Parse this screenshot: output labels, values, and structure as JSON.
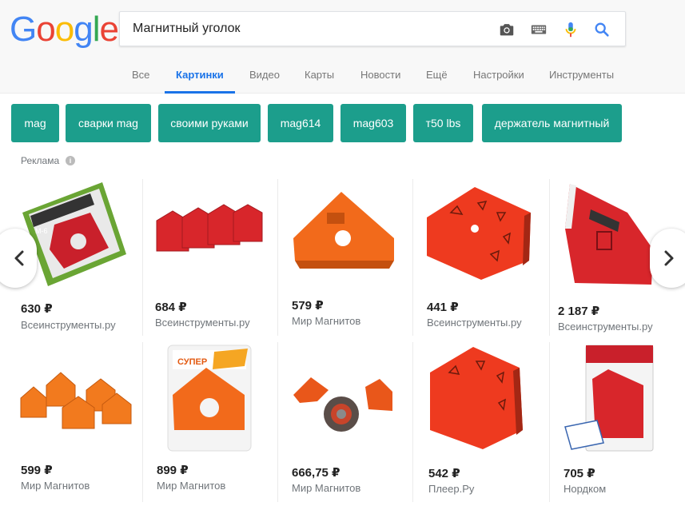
{
  "header": {
    "logo": [
      "G",
      "o",
      "o",
      "g",
      "l",
      "e"
    ],
    "logo_colors": [
      "#4285f4",
      "#ea4335",
      "#fbbc05",
      "#4285f4",
      "#34a853",
      "#ea4335"
    ],
    "search_value": "Магнитный уголок"
  },
  "tabs": [
    {
      "label": "Все"
    },
    {
      "label": "Картинки"
    },
    {
      "label": "Видео"
    },
    {
      "label": "Карты"
    },
    {
      "label": "Новости"
    },
    {
      "label": "Ещё"
    },
    {
      "label": "Настройки"
    },
    {
      "label": "Инструменты"
    }
  ],
  "chips": [
    "mag",
    "сварки mag",
    "своими руками",
    "mag614",
    "mag603",
    "т50 lbs",
    "держатель магнитный"
  ],
  "ad_label": "Реклама",
  "info_icon": "i",
  "products_row1": [
    {
      "price": "630 ₽",
      "store": "Всеинструменты.ру"
    },
    {
      "price": "684 ₽",
      "store": "Всеинструменты.ру"
    },
    {
      "price": "579 ₽",
      "store": "Мир Магнитов"
    },
    {
      "price": "441 ₽",
      "store": "Всеинструменты.ру"
    },
    {
      "price": "2 187 ₽",
      "store": "Всеинструменты.ру"
    }
  ],
  "products_row2": [
    {
      "price": "599 ₽",
      "store": "Мир Магнитов"
    },
    {
      "price": "899 ₽",
      "store": "Мир Магнитов"
    },
    {
      "price": "666,75 ₽",
      "store": "Мир Магнитов"
    },
    {
      "price": "542 ₽",
      "store": "Плеер.Ру"
    },
    {
      "price": "705 ₽",
      "store": "Нордком"
    }
  ],
  "colors": {
    "accent": "#1a73e8",
    "chip": "#1c9e8c",
    "magnet_red": "#d8262b",
    "magnet_orange": "#f26a1b"
  },
  "icons": [
    "camera-icon",
    "keyboard-icon",
    "mic-icon",
    "search-icon",
    "chevron-left-icon",
    "chevron-right-icon",
    "info-icon"
  ]
}
